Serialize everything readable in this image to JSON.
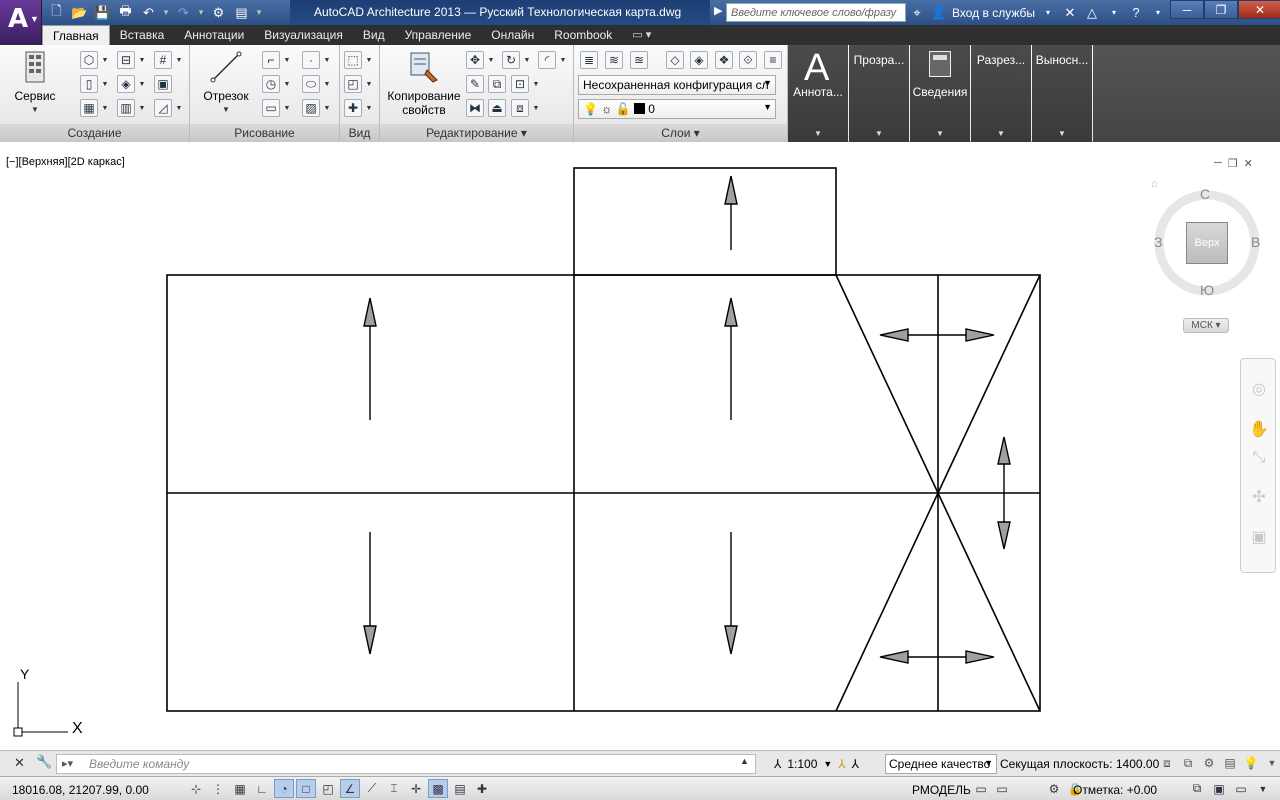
{
  "titlebar": {
    "title": "AutoCAD Architecture 2013 — Русский   Технологическая карта.dwg",
    "search_placeholder": "Введите ключевое слово/фразу",
    "signin_label": "Вход в службы"
  },
  "tabs": [
    "Главная",
    "Вставка",
    "Аннотации",
    "Визуализация",
    "Вид",
    "Управление",
    "Онлайн",
    "Roombook"
  ],
  "ribbon": {
    "service_label": "Сервис",
    "segment_label": "Отрезок",
    "copy_props_label_1": "Копирование",
    "copy_props_label_2": "свойств",
    "layer_state": "Несохраненная конфигурация сл",
    "layer_current": "0",
    "annot_label": "Аннота...",
    "panels": {
      "create": "Создание",
      "draw": "Рисование",
      "view": "Вид",
      "modify": "Редактирование",
      "layers": "Слои"
    },
    "dark_panels": [
      "Прозра...",
      "Сведения",
      "Разрез...",
      "Выносн..."
    ]
  },
  "viewport": {
    "label": "[−][Верхняя][2D каркас]",
    "cube_face": "Верх",
    "compass": {
      "n": "С",
      "s": "Ю",
      "w": "З",
      "e": "В"
    },
    "wcs": "МСК",
    "ucs_x": "X",
    "ucs_y": "Y"
  },
  "cmdline": {
    "placeholder": "Введите команду",
    "scale": "1:100",
    "quality": "Среднее качество",
    "cut_plane": "Секущая плоскость:  1400.00"
  },
  "statusbar": {
    "coords": "18016.08, 21207.99, 0.00",
    "model": "РМОДЕЛЬ",
    "elevation": "Отметка: +0.00"
  },
  "colors": {
    "title_bg": "#2b4f86",
    "tab_bg": "#2f2f2f",
    "dark_panel": "#444444",
    "line": "#000000",
    "arrow_fill": "#a0a0a0"
  }
}
